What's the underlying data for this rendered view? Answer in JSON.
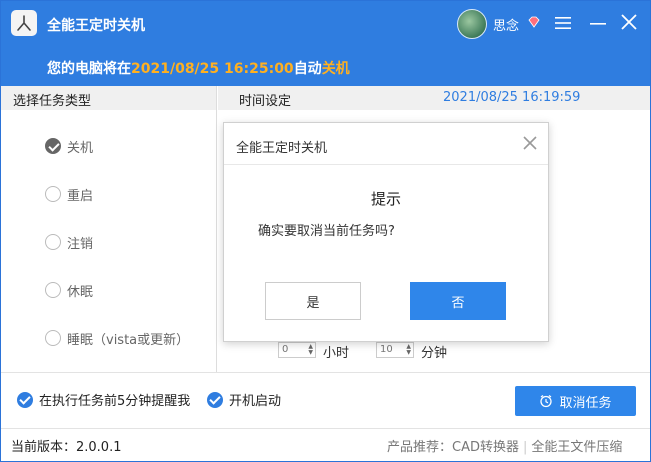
{
  "app": {
    "title": "全能王定时关机",
    "user_name": "思念",
    "icons": [
      "app-logo-icon",
      "vip-diamond-icon",
      "menu-icon",
      "minimize-icon",
      "close-icon"
    ]
  },
  "notice": {
    "prefix": "您的电脑将在",
    "datetime": "2021/08/25 16:25:00",
    "middle": "自动",
    "action": "关机"
  },
  "columns": {
    "left_header": "选择任务类型",
    "right_header": "时间设定",
    "current_time": "2021/08/25 16:19:59"
  },
  "task_types": [
    {
      "label": "关机",
      "checked": true
    },
    {
      "label": "重启",
      "checked": false
    },
    {
      "label": "注销",
      "checked": false
    },
    {
      "label": "休眠",
      "checked": false
    },
    {
      "label": "睡眠（vista或更新）",
      "checked": false
    }
  ],
  "countdown": {
    "hours_value": "0",
    "hours_label": "小时",
    "minutes_value": "10",
    "minutes_label": "分钟"
  },
  "options": {
    "remind_label": "在执行任务前5分钟提醒我",
    "autostart_label": "开机启动"
  },
  "cancel_task_label": "取消任务",
  "status": {
    "version": "当前版本：2.0.0.1",
    "recommend_prefix": "产品推荐：",
    "recommend_1": "CAD转换器",
    "recommend_2": "全能王文件压缩"
  },
  "dialog": {
    "title": "全能王定时关机",
    "heading": "提示",
    "message": "确实要取消当前任务吗?",
    "yes_label": "是",
    "no_label": "否"
  },
  "colors": {
    "accent": "#2f7de0",
    "highlight": "#ffb020",
    "button_blue": "#2f86ea"
  }
}
